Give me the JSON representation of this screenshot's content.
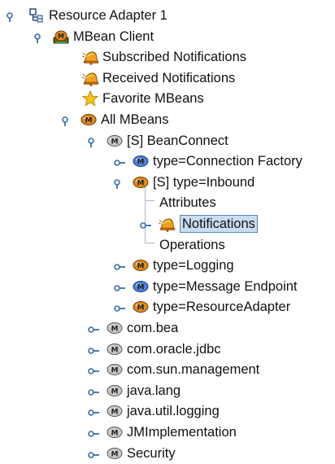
{
  "tree": {
    "root": {
      "label": "Resource Adapter 1"
    },
    "mbean_client": {
      "label": "MBean Client"
    },
    "subscribed": {
      "label": "Subscribed Notifications"
    },
    "received": {
      "label": "Received Notifications"
    },
    "favorite": {
      "label": "Favorite MBeans"
    },
    "all_mbeans": {
      "label": "All MBeans"
    },
    "beanconnect": {
      "label": "[S] BeanConnect"
    },
    "conn_factory": {
      "label": "type=Connection Factory"
    },
    "inbound": {
      "label": "[S] type=Inbound"
    },
    "attributes": {
      "label": "Attributes"
    },
    "notifications": {
      "label": "Notifications"
    },
    "operations": {
      "label": "Operations"
    },
    "logging_type": {
      "label": "type=Logging"
    },
    "msg_endpoint": {
      "label": "type=Message Endpoint"
    },
    "resource_adapter_type": {
      "label": "type=ResourceAdapter"
    },
    "com_bea": {
      "label": "com.bea"
    },
    "com_oracle_jdbc": {
      "label": "com.oracle.jdbc"
    },
    "com_sun_management": {
      "label": "com.sun.management"
    },
    "java_lang": {
      "label": "java.lang"
    },
    "java_util_logging": {
      "label": "java.util.logging"
    },
    "jmimplementation": {
      "label": "JMImplementation"
    },
    "security": {
      "label": "Security"
    }
  },
  "colors": {
    "selection_background": "#c9dcf0",
    "selection_border": "#5a86b6",
    "tree_lines": "#a8b8c8",
    "handle": "#3a6ea5"
  },
  "icons": {
    "root": "adapter-tree-icon",
    "mbean_client": "mbean-client-icon",
    "notification": "bell-icon",
    "favorite": "star-icon",
    "mbean_orange": "mbean-orange-icon",
    "mbean_gray": "mbean-gray-icon",
    "mbean_blue": "mbean-blue-icon"
  }
}
